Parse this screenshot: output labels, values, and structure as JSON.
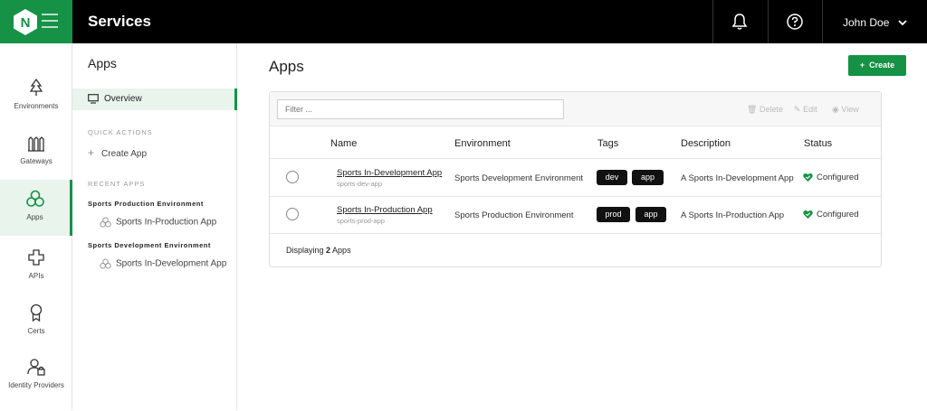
{
  "header": {
    "title": "Services",
    "user_name": "John Doe",
    "logo_letter": "N",
    "brand_color": "#159245"
  },
  "left_nav": [
    {
      "label": "Environments",
      "icon": "tree-icon"
    },
    {
      "label": "Gateways",
      "icon": "gateway-icon"
    },
    {
      "label": "Apps",
      "icon": "apps-icon"
    },
    {
      "label": "APIs",
      "icon": "api-icon"
    },
    {
      "label": "Certs",
      "icon": "certificate-icon"
    },
    {
      "label": "Identity Providers",
      "icon": "identity-icon"
    }
  ],
  "sidebar": {
    "title": "Apps",
    "overview_label": "Overview",
    "quick_actions_label": "QUICK ACTIONS",
    "create_app_label": "Create App",
    "recent_apps_label": "RECENT APPS",
    "recent_groups": [
      {
        "environment": "Sports Production Environment",
        "app": "Sports In-Production App"
      },
      {
        "environment": "Sports Development Environment",
        "app": "Sports In-Development App"
      }
    ]
  },
  "main": {
    "title": "Apps",
    "create_button": "Create",
    "filter_placeholder": "Filter ...",
    "actions": {
      "delete": "Delete",
      "edit": "Edit",
      "view": "View"
    },
    "columns": [
      "Name",
      "Environment",
      "Tags",
      "Description",
      "Status"
    ],
    "rows": [
      {
        "name": "Sports In-Development App",
        "slug": "sports-dev-app",
        "environment": "Sports Development Environment",
        "tags": [
          "dev",
          "app"
        ],
        "description": "A Sports In-Development App",
        "status": "Configured"
      },
      {
        "name": "Sports In-Production App",
        "slug": "sports-prod-app",
        "environment": "Sports Production Environment",
        "tags": [
          "prod",
          "app"
        ],
        "description": "A Sports In-Production App",
        "status": "Configured"
      }
    ],
    "footer_prefix": "Displaying ",
    "footer_count": "2",
    "footer_suffix": " Apps"
  }
}
